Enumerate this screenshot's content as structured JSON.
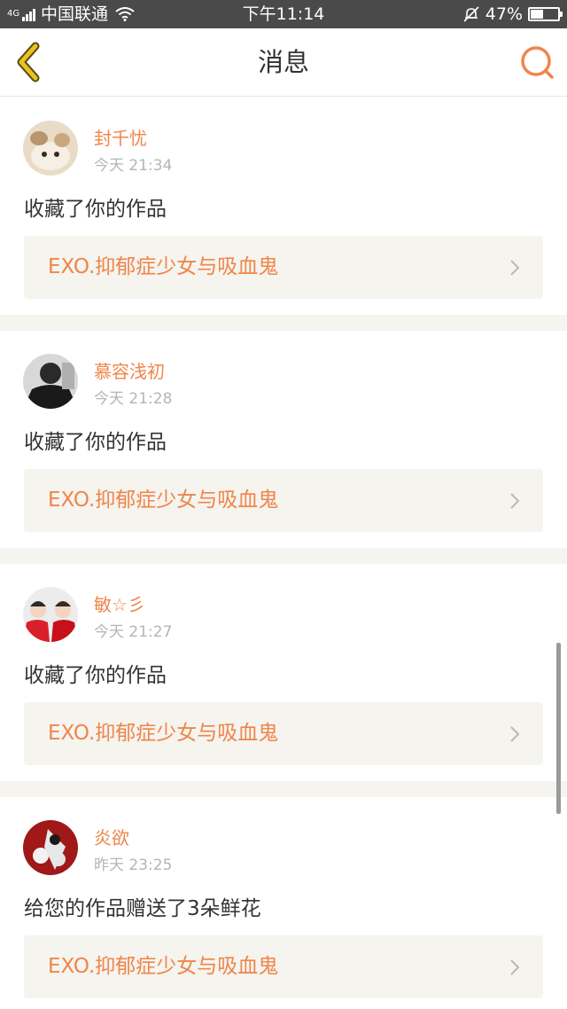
{
  "status_bar": {
    "network": "4G",
    "carrier": "中国联通",
    "time": "下午11:14",
    "battery_percent": "47%",
    "battery_level": 0.47
  },
  "header": {
    "title": "消息",
    "back_icon": "chevron-left-icon",
    "search_icon": "search-icon"
  },
  "messages": [
    {
      "user": "封千忧",
      "time": "今天 21:34",
      "action": "收藏了你的作品",
      "work": "EXO.抑郁症少女与吸血鬼"
    },
    {
      "user": "慕容浅初",
      "time": "今天 21:28",
      "action": "收藏了你的作品",
      "work": "EXO.抑郁症少女与吸血鬼"
    },
    {
      "user": "敏☆彡",
      "time": "今天 21:27",
      "action": "收藏了你的作品",
      "work": "EXO.抑郁症少女与吸血鬼"
    },
    {
      "user": "炎欲",
      "time": "昨天 23:25",
      "action": "给您的作品赠送了3朵鲜花",
      "work": "EXO.抑郁症少女与吸血鬼"
    }
  ],
  "colors": {
    "accent": "#f0854a",
    "back_icon": "#e8c51c",
    "card_link_bg": "#f5f4ef",
    "status_bar_bg": "#4a4a4a"
  }
}
